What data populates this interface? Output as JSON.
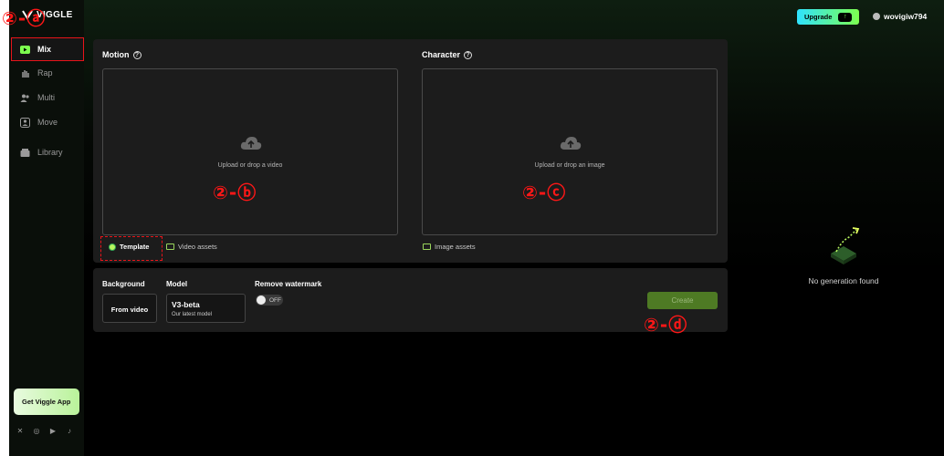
{
  "brand": {
    "name": "VIGGLE"
  },
  "nav": {
    "items": [
      {
        "label": "Mix",
        "icon": "play-icon"
      },
      {
        "label": "Rap",
        "icon": "hand-icon"
      },
      {
        "label": "Multi",
        "icon": "people-icon"
      },
      {
        "label": "Move",
        "icon": "person-box-icon"
      },
      {
        "label": "Library",
        "icon": "box-icon"
      }
    ]
  },
  "sidebar": {
    "app_card": "Get Viggle App"
  },
  "header": {
    "upgrade_label": "Upgrade",
    "username": "wovigiw794"
  },
  "motion": {
    "title": "Motion",
    "upload_text": "Upload or drop a video",
    "template_label": "Template",
    "assets_label": "Video assets"
  },
  "character": {
    "title": "Character",
    "upload_text": "Upload or drop an image",
    "assets_label": "Image assets"
  },
  "options": {
    "background_label": "Background",
    "background_value": "From video",
    "model_label": "Model",
    "model_name": "V3-beta",
    "model_desc": "Our latest model",
    "watermark_label": "Remove watermark",
    "watermark_state": "OFF",
    "create_label": "Create"
  },
  "results": {
    "empty_text": "No generation found"
  },
  "annotations": {
    "a": "②-ⓐ",
    "b": "②-ⓑ",
    "c": "②-ⓒ",
    "d": "②-ⓓ"
  },
  "colors": {
    "accent": "#7dff4f",
    "highlight": "#e8141a",
    "create": "#4e7a24"
  }
}
